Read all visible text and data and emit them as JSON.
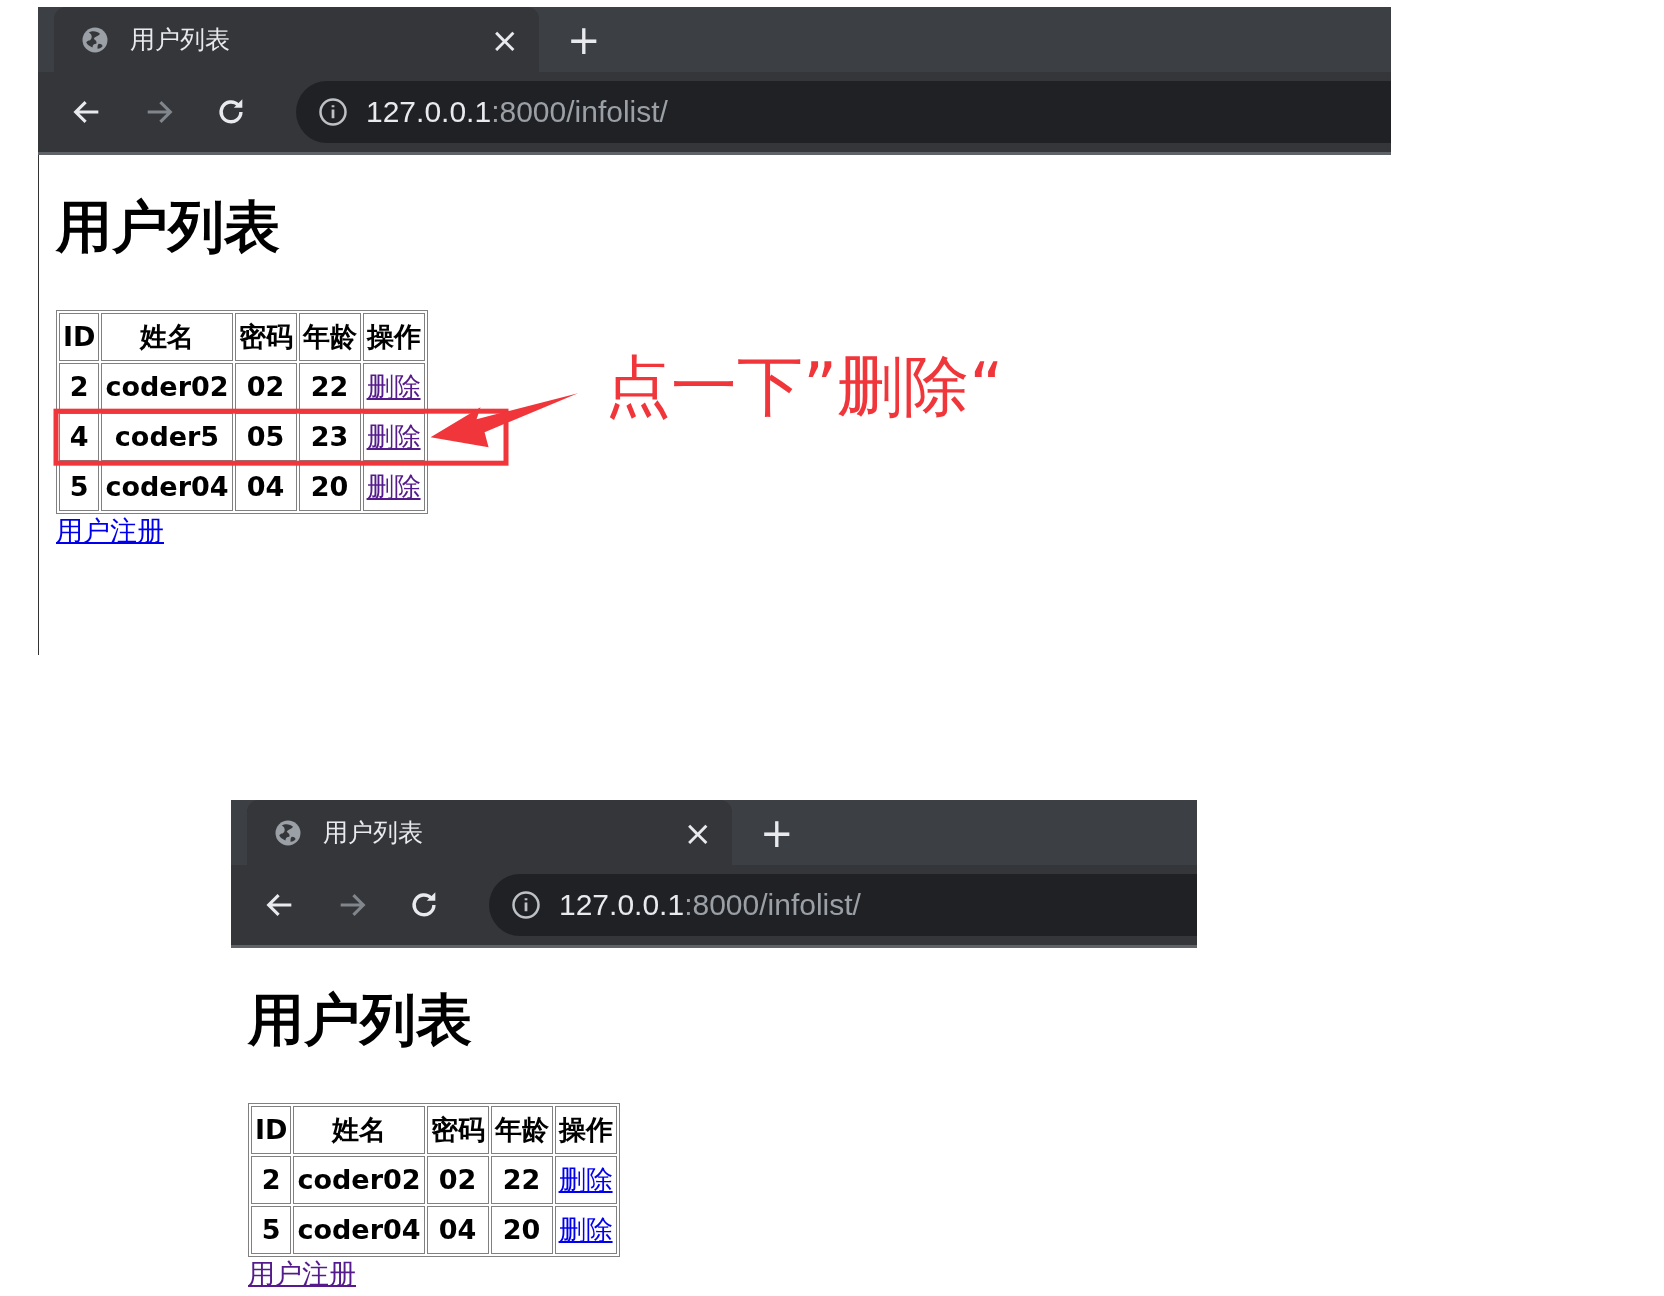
{
  "screenshots": [
    {
      "tab": {
        "title": "用户列表",
        "close": "×",
        "new_tab": "+"
      },
      "address": {
        "host": "127.0.0.1",
        "path": ":8000/infolist/"
      },
      "heading": "用户列表",
      "table": {
        "columns": [
          "ID",
          "姓名",
          "密码",
          "年龄",
          "操作"
        ],
        "rows": [
          {
            "cells": [
              "2",
              "coder02",
              "02",
              "22"
            ],
            "action": {
              "text": "删除",
              "visited": true
            },
            "highlighted": false
          },
          {
            "cells": [
              "4",
              "coder5",
              "05",
              "23"
            ],
            "action": {
              "text": "删除",
              "visited": true
            },
            "highlighted": true
          },
          {
            "cells": [
              "5",
              "coder04",
              "04",
              "20"
            ],
            "action": {
              "text": "删除",
              "visited": true
            },
            "highlighted": false
          }
        ]
      },
      "register_link": {
        "text": "用户注册",
        "visited": false
      },
      "annotation": {
        "text": "点一下”删除“"
      }
    },
    {
      "tab": {
        "title": "用户列表",
        "close": "×",
        "new_tab": "+"
      },
      "address": {
        "host": "127.0.0.1",
        "path": ":8000/infolist/"
      },
      "heading": "用户列表",
      "table": {
        "columns": [
          "ID",
          "姓名",
          "密码",
          "年龄",
          "操作"
        ],
        "rows": [
          {
            "cells": [
              "2",
              "coder02",
              "02",
              "22"
            ],
            "action": {
              "text": "删除",
              "visited": false
            }
          },
          {
            "cells": [
              "5",
              "coder04",
              "04",
              "20"
            ],
            "action": {
              "text": "删除",
              "visited": false
            }
          }
        ]
      },
      "register_link": {
        "text": "用户注册",
        "visited": true
      }
    }
  ]
}
